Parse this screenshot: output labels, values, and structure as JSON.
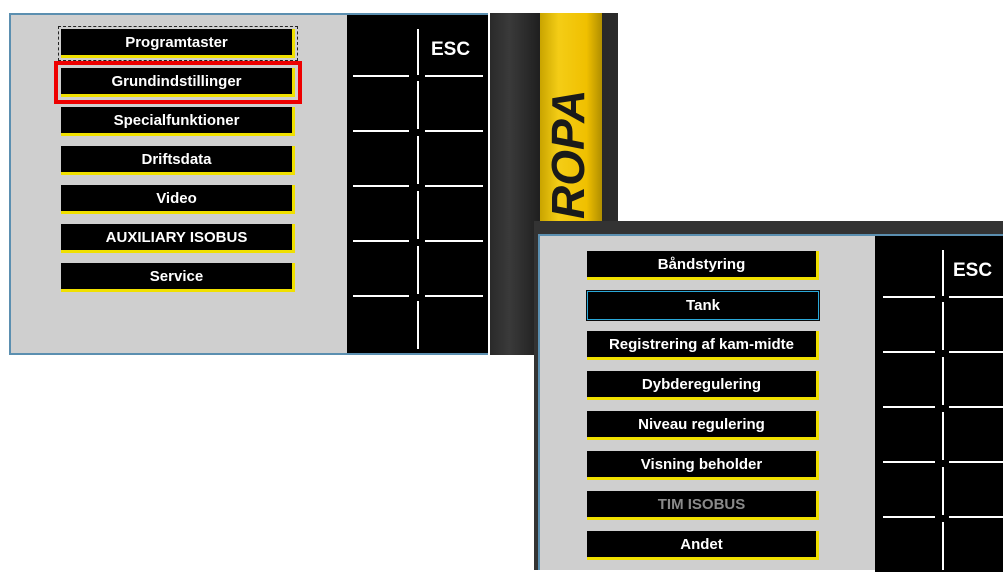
{
  "screen1": {
    "menu": [
      {
        "label": "Programtaster",
        "state": "focused"
      },
      {
        "label": "Grundindstillinger",
        "state": "highlighted"
      },
      {
        "label": "Specialfunktioner",
        "state": "normal"
      },
      {
        "label": "Driftsdata",
        "state": "normal"
      },
      {
        "label": "Video",
        "state": "normal"
      },
      {
        "label": "AUXILIARY ISOBUS",
        "state": "normal"
      },
      {
        "label": "Service",
        "state": "normal"
      }
    ],
    "esc_label": "ESC"
  },
  "brand": {
    "text": "ROPA",
    "band_color": "#f4cd16"
  },
  "screen2": {
    "menu": [
      {
        "label": "Båndstyring",
        "state": "normal"
      },
      {
        "label": "Tank",
        "state": "focused"
      },
      {
        "label": "Registrering af kam-midte",
        "state": "normal"
      },
      {
        "label": "Dybderegulering",
        "state": "normal"
      },
      {
        "label": "Niveau regulering",
        "state": "normal"
      },
      {
        "label": "Visning beholder",
        "state": "normal"
      },
      {
        "label": "TIM ISOBUS",
        "state": "disabled"
      },
      {
        "label": "Andet",
        "state": "normal"
      }
    ],
    "esc_label": "ESC"
  },
  "colors": {
    "button_border": "#f0e000",
    "highlight_red": "#ee0000",
    "focus_blue": "#2aa8d8",
    "panel_bg": "#cfcfcf"
  }
}
